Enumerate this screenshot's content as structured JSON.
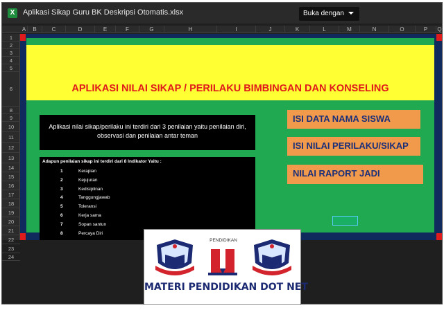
{
  "viewer": {
    "file_icon": "X",
    "file_title": "Aplikasi Sikap Guru BK Deskripsi Otomatis.xlsx",
    "open_with_label": "Buka dengan"
  },
  "columns": [
    "A",
    "B",
    "C",
    "D",
    "E",
    "F",
    "G",
    "H",
    "I",
    "J",
    "K",
    "L",
    "M",
    "N",
    "O",
    "P",
    "Q"
  ],
  "rows": [
    "1",
    "2",
    "3",
    "4",
    "5",
    "6",
    "8",
    "9",
    "10",
    "11",
    "12",
    "13",
    "14",
    "15",
    "16",
    "17",
    "18",
    "19",
    "20",
    "21",
    "22",
    "23",
    "24"
  ],
  "sheet": {
    "title": "APLIKASI NILAI SIKAP / PERILAKU BIMBINGAN DAN KONSELING",
    "description": "Aplikasi nilai sikap/perilaku ini terdiri dari 3 penilaian yaitu penilaian diri, observasi dan penilaian antar teman",
    "indicator_title": "Adapun penilaian sikap ini terdiri dari 8 Indikator Yaitu :",
    "indicators": [
      {
        "num": "1",
        "label": "Kerapian"
      },
      {
        "num": "2",
        "label": "Kejujuran"
      },
      {
        "num": "3",
        "label": "Kedisiplinan"
      },
      {
        "num": "4",
        "label": "Tanggungjawab"
      },
      {
        "num": "5",
        "label": "Toleransi"
      },
      {
        "num": "6",
        "label": "Kerja sama"
      },
      {
        "num": "7",
        "label": "Sopan santun"
      },
      {
        "num": "8",
        "label": "Percaya Diri"
      }
    ],
    "buttons": {
      "isi_nama": "ISI DATA NAMA SISWA",
      "isi_nilai": "ISI NILAI PERILAKU/SIKAP",
      "raport": "NILAI RAPORT JADI"
    }
  },
  "logo": {
    "top_text": "PENDIDIKAN",
    "caption": "MATERI PENDIDIKAN DOT NET"
  },
  "colors": {
    "green": "#21a952",
    "yellow": "#ffff33",
    "title_red": "#e01a1a",
    "button_orange": "#f29a4b",
    "button_text": "#1a2f7a",
    "navy": "#102a5e"
  }
}
